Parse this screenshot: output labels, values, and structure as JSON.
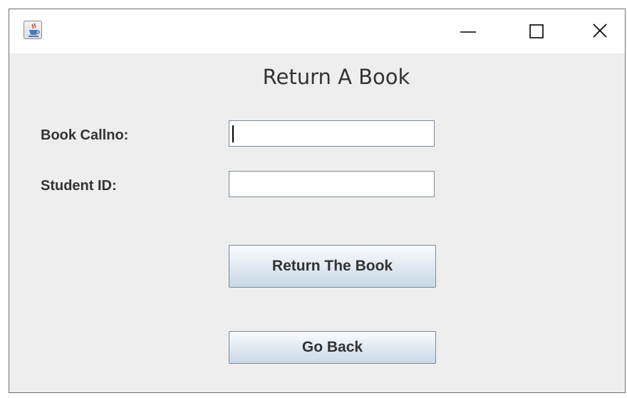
{
  "window": {
    "icon": "java-cup-icon",
    "controls": {
      "minimize_icon": "minimize-icon",
      "maximize_icon": "maximize-icon",
      "close_icon": "close-icon"
    }
  },
  "form": {
    "title": "Return A Book",
    "fields": [
      {
        "label": "Book Callno:",
        "value": ""
      },
      {
        "label": "Student ID:",
        "value": ""
      }
    ],
    "buttons": {
      "return_label": "Return The Book",
      "back_label": "Go Back"
    }
  },
  "colors": {
    "window_bg": "#eeeeee",
    "titlebar_bg": "#ffffff",
    "button_gradient_top": "#fbfcfd",
    "button_gradient_bottom": "#cad8e6",
    "text": "#333333"
  }
}
